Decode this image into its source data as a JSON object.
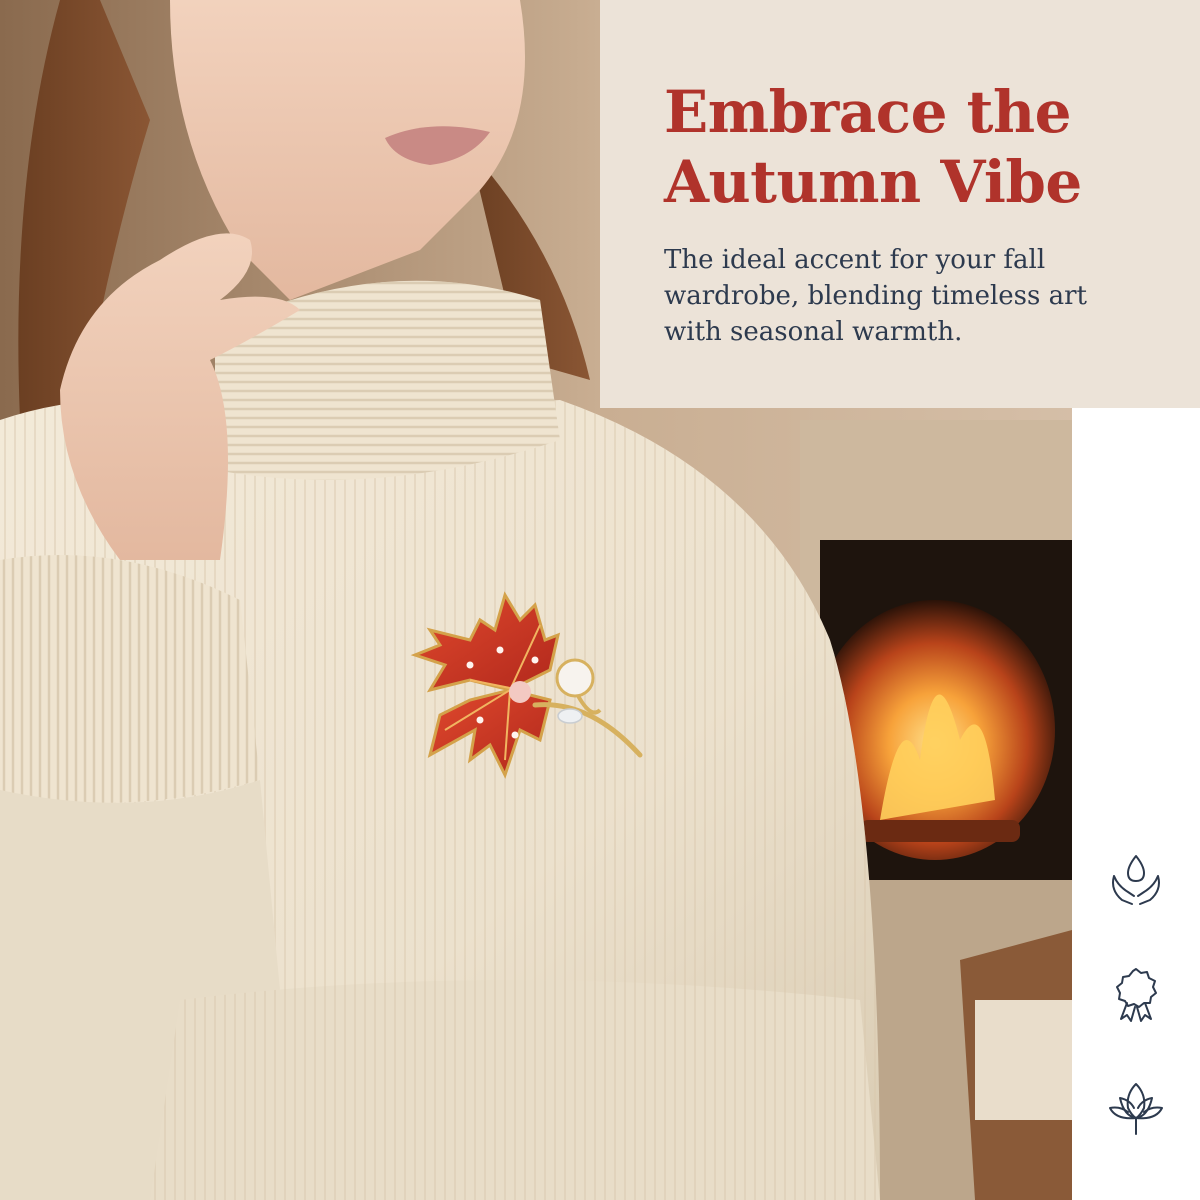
{
  "hero": {
    "title_line1": "Embrace the",
    "title_line2": "Autumn Vibe",
    "subtitle": "The ideal accent for your fall wardrobe, blending timeless art with seasonal warmth."
  },
  "feature_icons": [
    {
      "icon": "hands-drop-icon"
    },
    {
      "icon": "award-ribbon-icon"
    },
    {
      "icon": "lotus-icon"
    }
  ],
  "colors": {
    "accent_red": "#b0332b",
    "text_navy": "#2d3a4e",
    "card_bg": "#ece3d8",
    "sweater_cream": "#efe5d3"
  }
}
